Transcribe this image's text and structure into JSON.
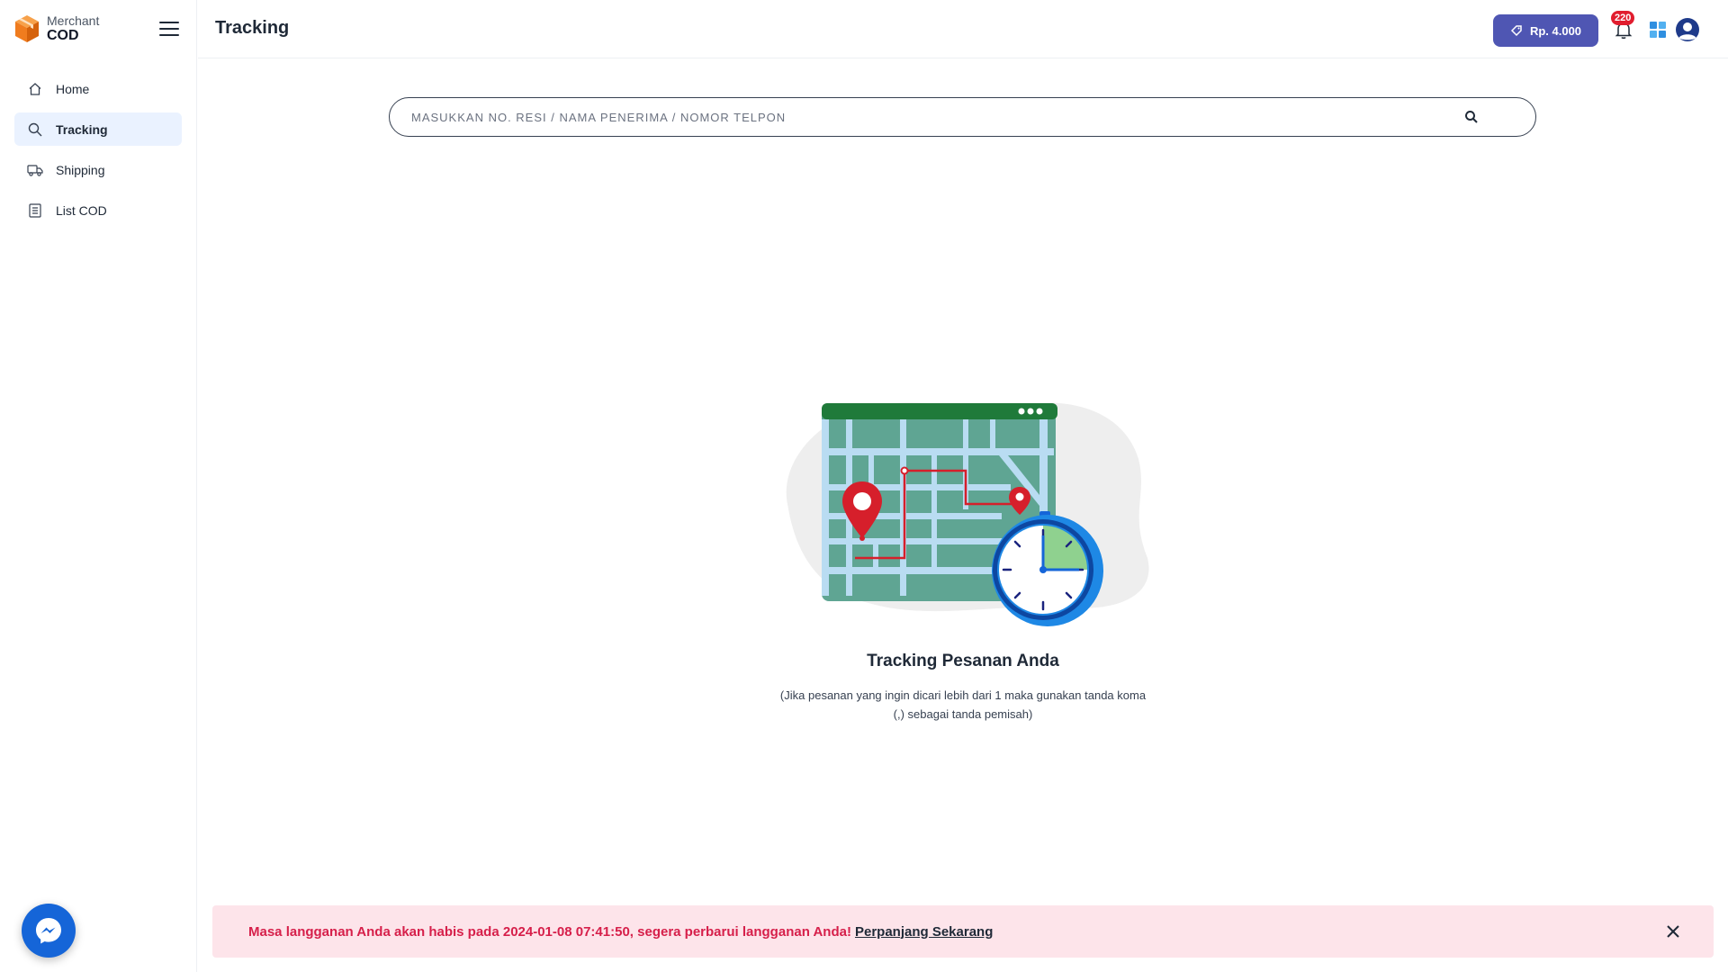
{
  "brand": {
    "line1": "Merchant",
    "line2": "COD",
    "logo_icon": "cube-logo-icon",
    "accent": "#f07c1e"
  },
  "sidebar": {
    "items": [
      {
        "label": "Home",
        "icon": "home-icon",
        "active": false
      },
      {
        "label": "Tracking",
        "icon": "search-icon",
        "active": true
      },
      {
        "label": "Shipping",
        "icon": "truck-icon",
        "active": false
      },
      {
        "label": "List COD",
        "icon": "document-list-icon",
        "active": false
      }
    ]
  },
  "header": {
    "title": "Tracking",
    "balance_label": "Rp. 4.000",
    "notification_count": "220",
    "brand_color": "#4f56b3"
  },
  "search": {
    "placeholder": "MASUKKAN NO. RESI / NAMA PENERIMA / NOMOR TELPON",
    "value": ""
  },
  "empty_state": {
    "title": "Tracking Pesanan Anda",
    "description": "(Jika pesanan yang ingin dicari lebih dari 1 maka gunakan tanda koma (,) sebagai tanda pemisah)",
    "illustration": "map-tracking-stopwatch-illustration"
  },
  "alert": {
    "message": "Masa langganan Anda akan habis pada 2024-01-08 07:41:50, segera perbarui langganan Anda!",
    "link_label": "Perpanjang Sekarang",
    "background": "#fde4ea",
    "text_color": "#d61f4a"
  }
}
